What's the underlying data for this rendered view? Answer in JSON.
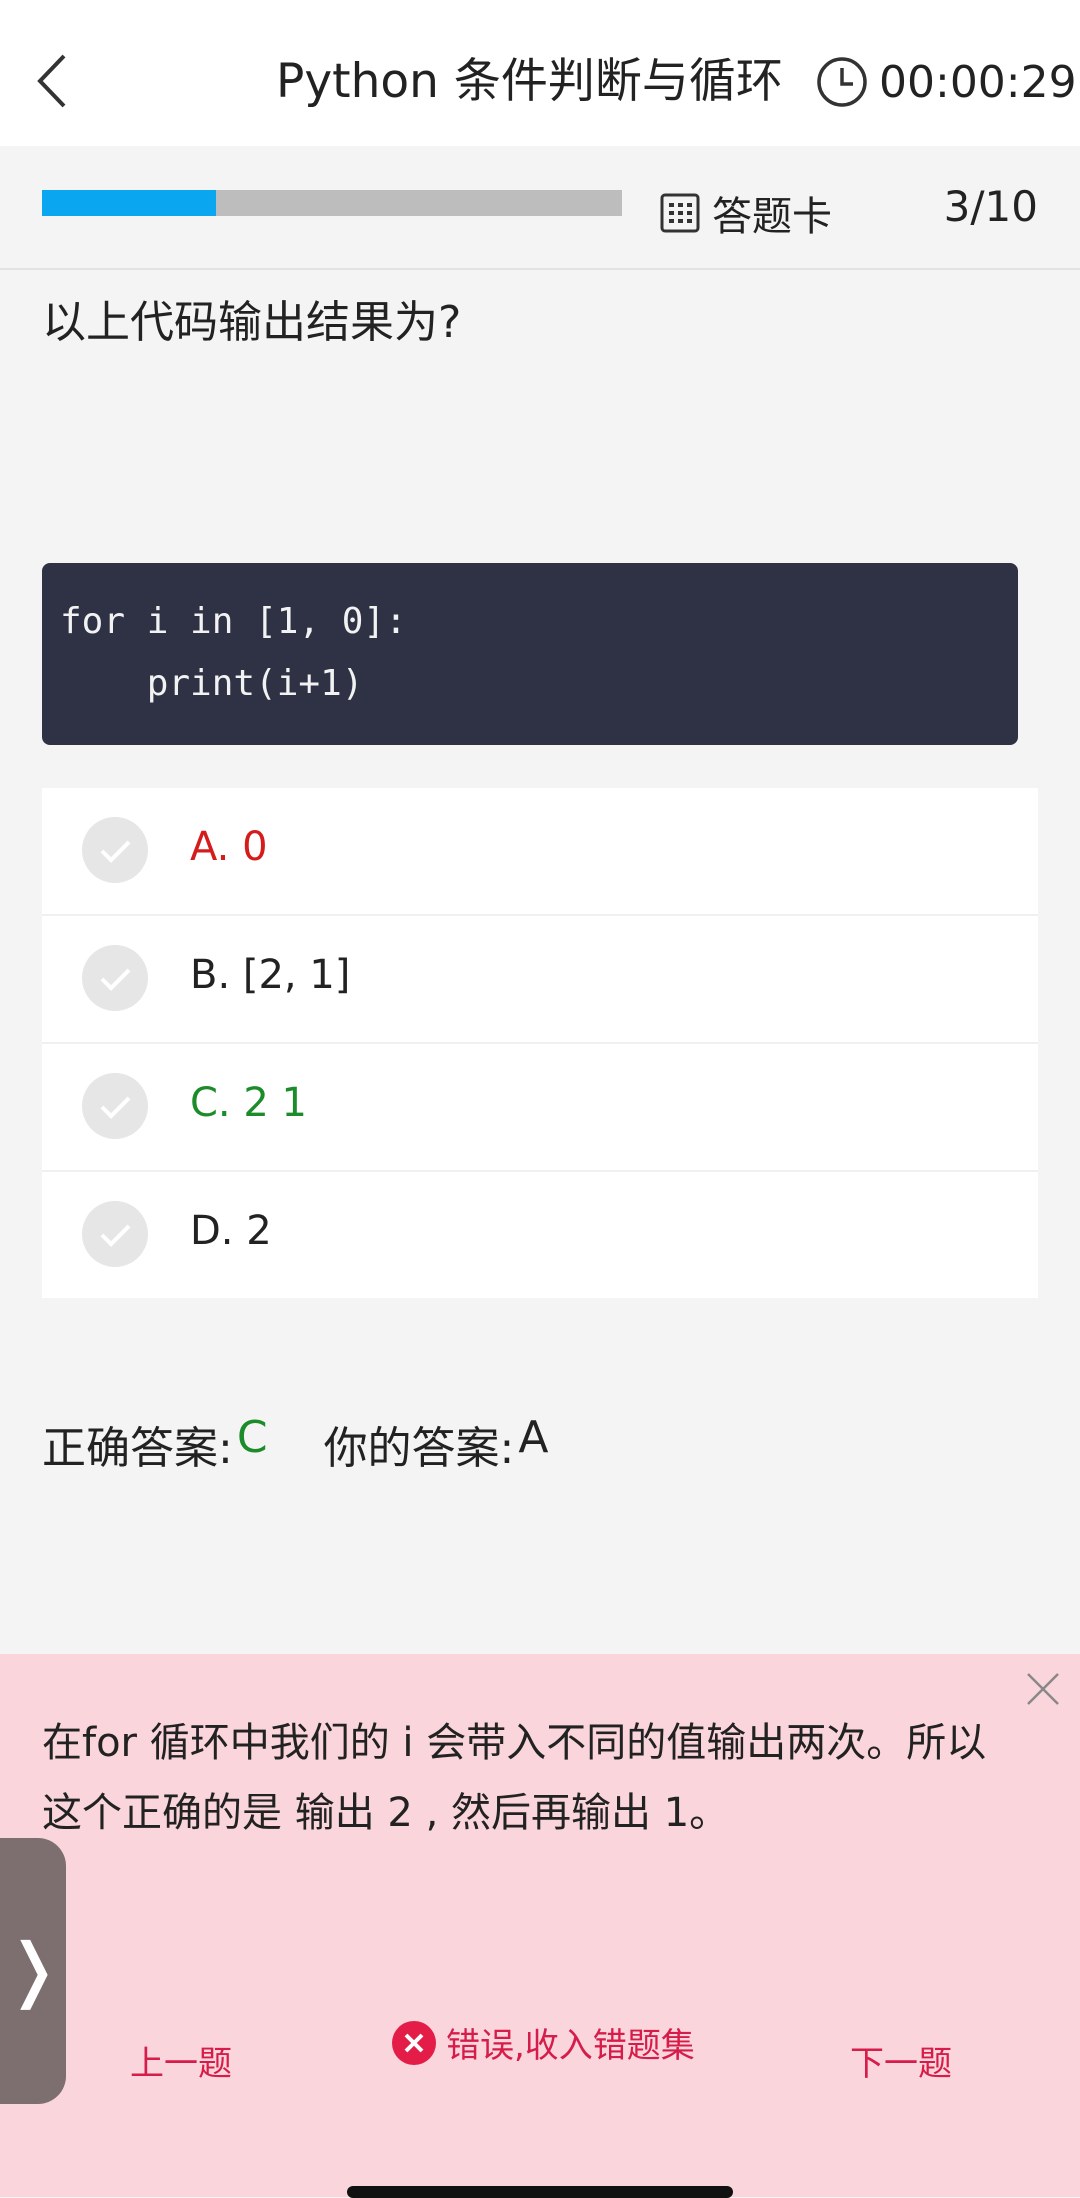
{
  "header": {
    "title": "Python 条件判断与循环",
    "timer": "00:00:29"
  },
  "progress": {
    "fraction": 0.3,
    "card_label": "答题卡",
    "counter": "3/10"
  },
  "question": {
    "text": "以上代码输出结果为?",
    "code": [
      "for i in [1, 0]:",
      "    print(i+1)"
    ]
  },
  "options": [
    {
      "label": "A. 0",
      "state": "wrong"
    },
    {
      "label": "B. [2, 1]",
      "state": "normal"
    },
    {
      "label": "C. 2 1",
      "state": "right"
    },
    {
      "label": "D. 2",
      "state": "normal"
    }
  ],
  "answer": {
    "correct_label": "正确答案:",
    "correct_value": "C",
    "yours_label": "你的答案:",
    "yours_value": "A"
  },
  "explanation": {
    "text": "在for 循环中我们的 i 会带入不同的值输出两次。所以这个正确的是 输出 2 , 然后再输出 1。"
  },
  "bottom_nav": {
    "prev": "上一题",
    "wrong": "错误,收入错题集",
    "next": "下一题",
    "side_tab": "❭"
  },
  "colors": {
    "accent": "#0aa6ef",
    "wrong": "#d51c1c",
    "right": "#1c8b2a",
    "panel": "#fad6dc"
  }
}
